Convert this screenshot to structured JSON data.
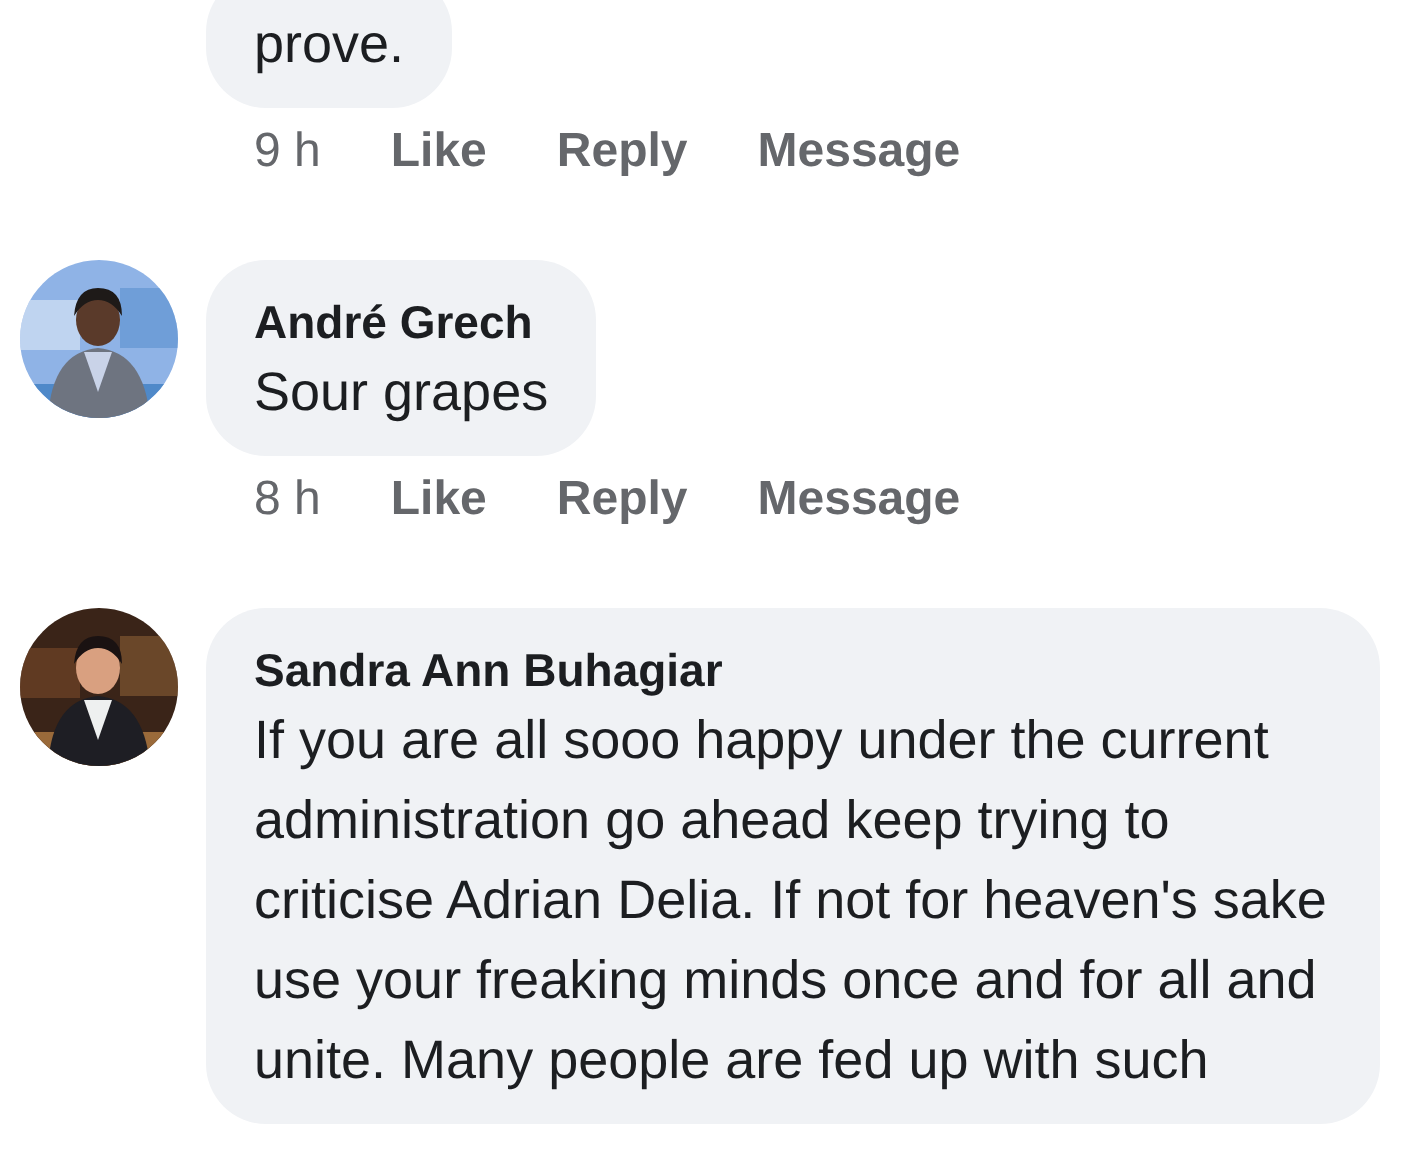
{
  "comments": [
    {
      "text": "prove.",
      "time": "9 h",
      "actions": [
        "Like",
        "Reply",
        "Message"
      ]
    },
    {
      "author": "André Grech",
      "text": "Sour grapes",
      "time": "8 h",
      "actions": [
        "Like",
        "Reply",
        "Message"
      ]
    },
    {
      "author": "Sandra Ann Buhagiar",
      "text": "If you are all sooo happy under the current administration go ahead keep trying to criticise Adrian Delia. If not for heaven's sake use your freaking minds once and for all and unite. Many people are fed up with such"
    }
  ]
}
